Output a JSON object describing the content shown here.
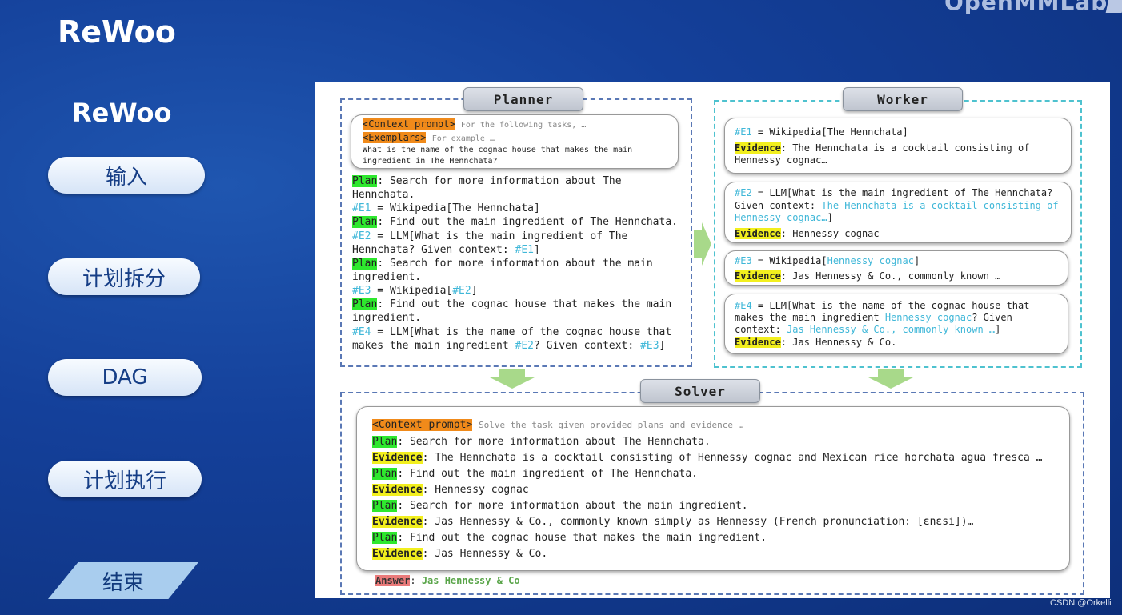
{
  "header": {
    "brand": "OpenMMLab",
    "title": "ReWoo",
    "subtitle": "ReWoo"
  },
  "nav": {
    "items": [
      {
        "label": "输入"
      },
      {
        "label": "计划拆分"
      },
      {
        "label": "DAG"
      },
      {
        "label": "计划执行"
      },
      {
        "label": "结束"
      }
    ]
  },
  "figure": {
    "planner": {
      "title": "Planner",
      "context_tag": "<Context prompt>",
      "context_text": "For the following tasks, …",
      "exemplars_tag": "<Exemplars>",
      "exemplars_text": "For example …",
      "question_1": "What is the name of the cognac house that makes the main",
      "question_2": "ingredient in The Hennchata?",
      "plan_tag": "Plan",
      "lines": {
        "l1_text": ": Search for more information about The",
        "l2_text": "Hennchata.",
        "l3_var": "#E1",
        "l3_text": " = Wikipedia[The Hennchata]",
        "l4_text": ": Find out the main ingredient of The Hennchata.",
        "l5_var": "#E2",
        "l5_text": " = LLM[What is the main ingredient of The",
        "l6_text": "Hennchata? Given context: ",
        "l6_ref": "#E1",
        "l6_end": "]",
        "l7_text": ": Search for more information about the main",
        "l8_text": "ingredient.",
        "l9_var": "#E3",
        "l9_text": " = Wikipedia[",
        "l9_ref": "#E2",
        "l9_end": "]",
        "l10_text": ": Find out the cognac house that makes the main",
        "l11_text": "ingredient.",
        "l12_var": "#E4",
        "l12_text": " = LLM[What is the name of the cognac house that",
        "l13_text": "makes the main ingredient ",
        "l13_ref": "#E2",
        "l13_mid": "? Given context: ",
        "l13_ref2": "#E3",
        "l13_end": "]"
      }
    },
    "worker": {
      "title": "Worker",
      "evidence_tag": "Evidence",
      "w1_var": "#E1",
      "w1_text": " = Wikipedia[The Hennchata]",
      "w1_ev": ": The Hennchata is a cocktail consisting of",
      "w1_ev2": "Hennessy cognac…",
      "w2_var": "#E2",
      "w2_text": " = LLM[What is the main ingredient of The Hennchata?",
      "w2_l2a": "Given context: ",
      "w2_l2b": "The Hennchata is a cocktail consisting of",
      "w2_l3a": "Hennessy cognac…",
      "w2_l3b": "]",
      "w2_ev": ": Hennessy cognac",
      "w3_var": "#E3",
      "w3_text": " = Wikipedia[",
      "w3_ref": "Hennessy cognac",
      "w3_end": "]",
      "w3_ev": ": Jas Hennessy & Co., commonly known …",
      "w4_var": "#E4",
      "w4_text": " = LLM[What is the name of the cognac house that",
      "w4_l2a": "makes the main ingredient ",
      "w4_l2b": "Hennessy cognac",
      "w4_l2c": "? Given",
      "w4_l3a": "context: ",
      "w4_l3b": "Jas Hennessy & Co., commonly known …",
      "w4_l3c": "]",
      "w4_ev": ": Jas Hennessy & Co."
    },
    "solver": {
      "title": "Solver",
      "context_tag": "<Context prompt>",
      "context_text": "Solve the task given provided plans and evidence …",
      "plan_tag": "Plan",
      "evidence_tag": "Evidence",
      "s1": ": Search for more information about The Hennchata.",
      "s2": ": The Hennchata is a cocktail consisting of Hennessy cognac and Mexican rice horchata agua fresca …",
      "s3": ": Find out the main ingredient of The Hennchata.",
      "s4": ": Hennessy cognac",
      "s5": ": Search for more information about the main ingredient.",
      "s6": ": Jas Hennessy & Co., commonly known simply as Hennessy (French pronunciation: [ɛnɛsi])…",
      "s7": ": Find out the cognac house that makes the main ingredient.",
      "s8": ": Jas Hennessy & Co.",
      "answer_tag": "Answer",
      "answer_sep": ": ",
      "answer_text": "Jas Hennessy & Co"
    }
  },
  "watermark": "CSDN @Orkelli",
  "colors": {
    "background": "#14409a",
    "planner_border": "#5a78b5",
    "worker_border": "#4ec2cf",
    "arrow": "#a8d98a"
  }
}
